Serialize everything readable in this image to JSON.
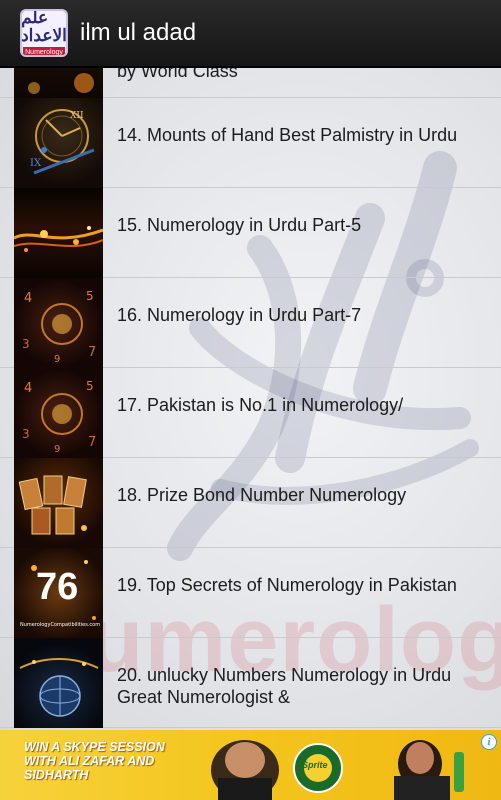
{
  "app": {
    "title": "ilm ul adad",
    "icon": {
      "glyph": "علم الاعداد",
      "tag": "Numerology"
    }
  },
  "list": {
    "partial_top_text": "by World Class",
    "items": [
      {
        "thumb": "clock-thumbnail",
        "title": "14. Mounts of Hand Best Palmistry in Urdu"
      },
      {
        "thumb": "sparks-thumbnail",
        "title": "15. Numerology in Urdu Part-5"
      },
      {
        "thumb": "numbers-swirl-thumbnail",
        "title": "16. Numerology in Urdu Part-7"
      },
      {
        "thumb": "numbers-swirl-thumbnail",
        "title": "17. Pakistan is No.1 in Numerology/"
      },
      {
        "thumb": "tarot-cards-thumbnail",
        "title": "18. Prize Bond Number Numerology"
      },
      {
        "thumb": "number-76-thumbnail",
        "thumb_number": "76",
        "thumb_caption": "NumerologyCompatibilities.com",
        "title": "19. Top Secrets of Numerology in Pakistan"
      },
      {
        "thumb": "globe-numbers-thumbnail",
        "title": "20. unlucky Numbers Numerology in Urdu Great Numerologist &"
      }
    ],
    "watermark_text": "numerology"
  },
  "ad": {
    "text": "WIN A SKYPE SESSION WITH ALI ZAFAR AND SIDHARTH",
    "brand": "Sprite",
    "info_icon": "info-icon"
  },
  "colors": {
    "action_bar": "#1e1e1e",
    "ad_background": "#f4c61f",
    "divider": "#c8cacd"
  }
}
